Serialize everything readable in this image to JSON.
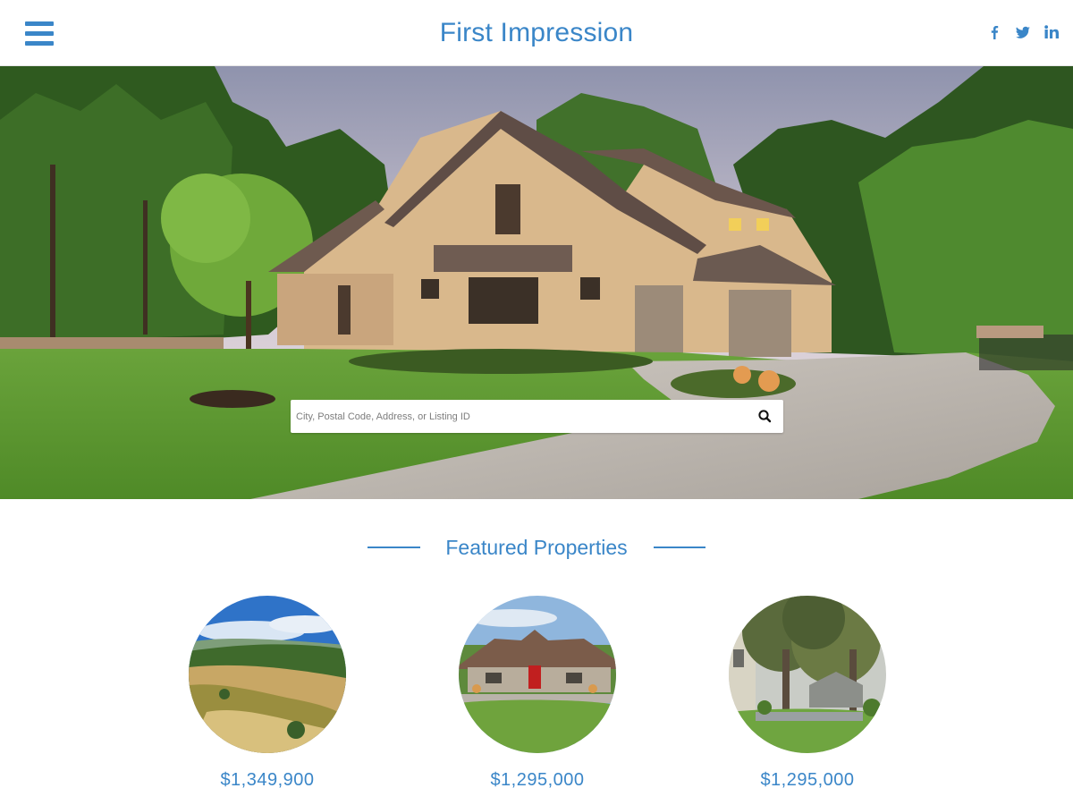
{
  "header": {
    "brand": "First Impression",
    "menu_icon": "hamburger-menu-icon",
    "social": [
      {
        "name": "facebook",
        "icon": "facebook-icon"
      },
      {
        "name": "twitter",
        "icon": "twitter-icon"
      },
      {
        "name": "linkedin",
        "icon": "linkedin-icon"
      }
    ]
  },
  "search": {
    "placeholder": "City, Postal Code, Address, or Listing ID",
    "icon": "search-icon"
  },
  "featured": {
    "title": "Featured Properties",
    "properties": [
      {
        "price": "$1,349,900",
        "image": "rolling-farmland-photo"
      },
      {
        "price": "$1,295,000",
        "image": "single-story-home-photo"
      },
      {
        "price": "$1,295,000",
        "image": "tree-shaded-home-photo"
      }
    ]
  },
  "colors": {
    "accent": "#3a86c8"
  }
}
